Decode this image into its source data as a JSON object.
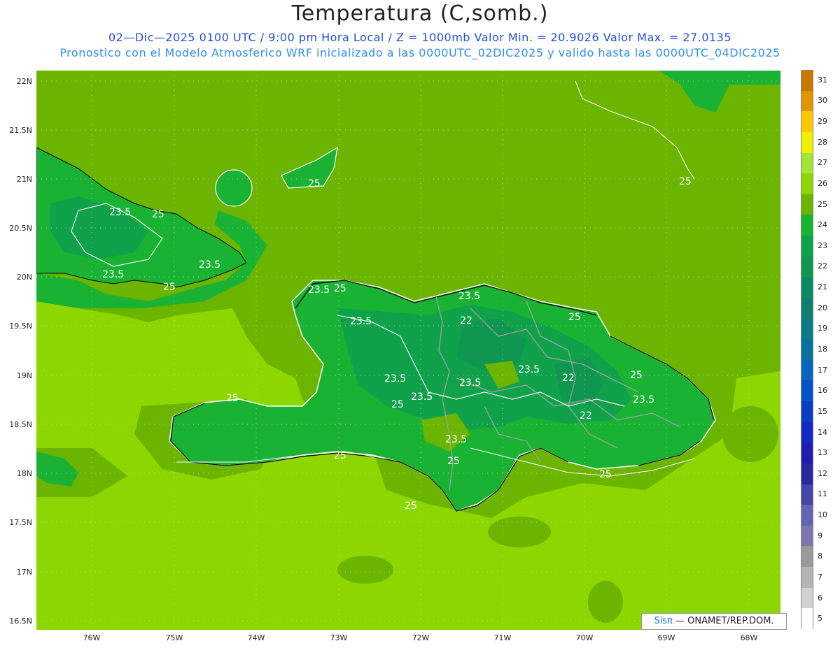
{
  "header": {
    "title": "Temperatura (C,somb.)",
    "subtitle_line1": "02—Dic—2025  0100 UTC / 9:00 pm Hora Local / Z = 1000mb   Valor Min. = 20.9026  Valor Max. = 27.0135",
    "subtitle_line2": "Pronostico con el Modelo Atmosferico WRF inicializado a las 0000UTC_02DIC2025 y valido hasta las  0000UTC_04DIC2025"
  },
  "map": {
    "lat_labels": [
      "22N",
      "21.5N",
      "21N",
      "20.5N",
      "20N",
      "19.5N",
      "19N",
      "18.5N",
      "18N",
      "17.5N",
      "17N",
      "16.5N"
    ],
    "lon_labels": [
      "76W",
      "75W",
      "74W",
      "73W",
      "72W",
      "71W",
      "70W",
      "69W",
      "68W"
    ],
    "contour_labels": [
      "25",
      "23.5",
      "25",
      "23.5",
      "23.5",
      "25",
      "23.5",
      "25",
      "23.5",
      "23.5",
      "22",
      "25",
      "23.5",
      "23.5",
      "22",
      "23.5",
      "23.5",
      "25",
      "23.5",
      "22",
      "25",
      "23.5",
      "25",
      "25",
      "25",
      "25",
      "25",
      "25"
    ],
    "colors": {
      "land_dark": "#10a24a",
      "land_mid": "#19b233",
      "ocean_25": "#6bb400",
      "ocean_26": "#8cd700",
      "coast": "#000000",
      "borders": "#a0a0a0",
      "contour": "#ffffff"
    }
  },
  "colorbar": {
    "levels": [
      "31",
      "30",
      "29",
      "28",
      "27",
      "26",
      "25",
      "24",
      "23",
      "22",
      "21",
      "20",
      "19",
      "18",
      "17",
      "16",
      "15",
      "14",
      "13",
      "12",
      "11",
      "10",
      "9",
      "8",
      "7",
      "6",
      "5"
    ],
    "colors": [
      "#c87800",
      "#e19600",
      "#ffc800",
      "#f0f000",
      "#a0e632",
      "#8cd700",
      "#6bb400",
      "#19b233",
      "#10a24a",
      "#0f9650",
      "#0e8a62",
      "#0d8072",
      "#0b7a88",
      "#08729e",
      "#0666bc",
      "#0452c8",
      "#0a3cc8",
      "#1428c8",
      "#1e1eb4",
      "#2828a0",
      "#4646a8",
      "#6464b4",
      "#7e74b0",
      "#9a9a9a",
      "#b4b4b4",
      "#d2d2d2",
      "#ffffff"
    ]
  },
  "credit": {
    "brand": "Sisπ",
    "text": " — ONAMET/REP.DOM."
  }
}
